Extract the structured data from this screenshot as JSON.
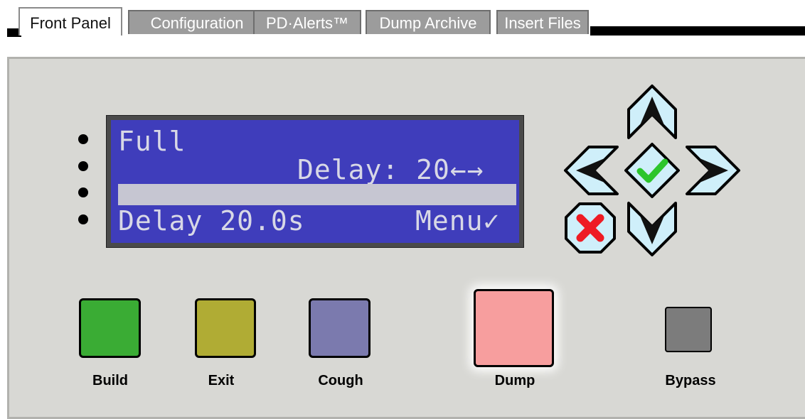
{
  "tabs": [
    {
      "label": "Front Panel",
      "active": true
    },
    {
      "label": "Configuration",
      "active": false
    },
    {
      "label": "PD·Alerts™",
      "active": false
    },
    {
      "label": "Dump Archive",
      "active": false
    },
    {
      "label": "Insert Files",
      "active": false
    }
  ],
  "lcd": {
    "line1": "Full",
    "line2": "Delay: 20←→",
    "line3_left": "Delay 20.0s",
    "line3_right": "Menu✓"
  },
  "nav_icons": {
    "up": "arrow-up-icon",
    "down": "arrow-down-icon",
    "left": "arrow-left-icon",
    "right": "arrow-right-icon",
    "ok": "checkmark-icon",
    "cancel": "x-cross-icon"
  },
  "buttons": {
    "build": {
      "label": "Build",
      "color": "#3aac34"
    },
    "exit": {
      "label": "Exit",
      "color": "#b0ac34"
    },
    "cough": {
      "label": "Cough",
      "color": "#7b7aae"
    },
    "dump": {
      "label": "Dump",
      "color": "#f79e9e"
    },
    "bypass": {
      "label": "Bypass",
      "color": "#7c7c7c"
    }
  },
  "colors": {
    "lcd_background": "#3f3dbb",
    "panel": "#d8d8d4",
    "nav_key_fill": "#cfeffa",
    "cancel_fill": "#ee1b24",
    "ok_check": "#2cc52c"
  }
}
